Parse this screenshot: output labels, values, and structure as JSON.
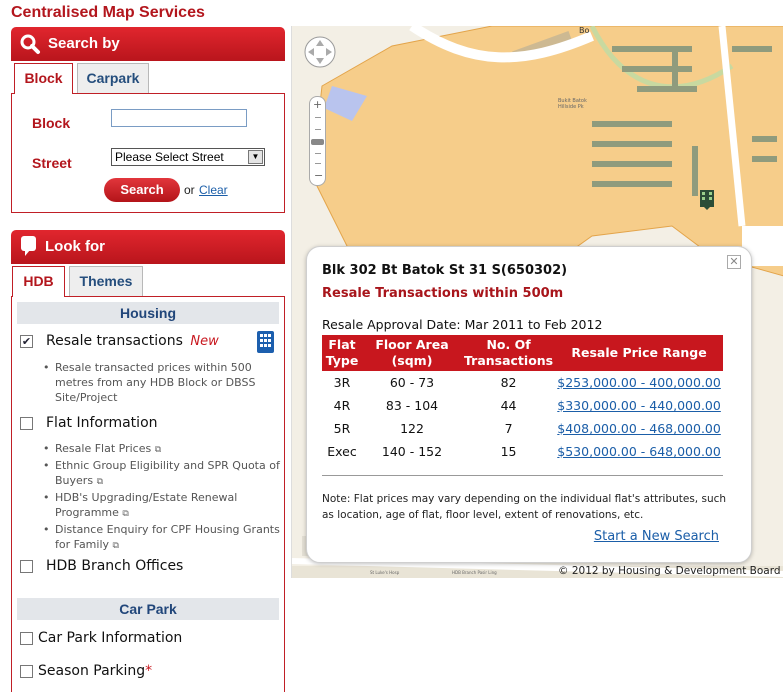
{
  "app_title": "Centralised Map Services",
  "search_panel": {
    "title": "Search by",
    "tabs": [
      {
        "label": "Block"
      },
      {
        "label": "Carpark"
      }
    ],
    "block_label": "Block",
    "block_value": "",
    "street_label": "Street",
    "street_selected": "Please Select Street",
    "search_button": "Search",
    "or_text": "or",
    "clear_link": "Clear"
  },
  "lookfor_panel": {
    "title": "Look for",
    "tabs": [
      {
        "label": "HDB"
      },
      {
        "label": "Themes"
      }
    ],
    "housing": {
      "heading": "Housing",
      "resale": {
        "label": "Resale transactions",
        "new_badge": "New",
        "checked": true,
        "description": "Resale transacted prices within 500 metres from any HDB Block or DBSS Site/Project"
      },
      "flat_info": {
        "label": "Flat Information",
        "checked": false,
        "links": [
          "Resale Flat Prices",
          "Ethnic Group Eligibility and SPR Quota of Buyers",
          "HDB's Upgrading/Estate Renewal Programme",
          "Distance Enquiry for CPF Housing Grants for Family"
        ]
      },
      "branch_offices": {
        "label": "HDB Branch Offices",
        "checked": false
      }
    },
    "car_park": {
      "heading": "Car Park",
      "info": {
        "label": "Car Park Information",
        "checked": false
      },
      "season": {
        "label": "Season Parking",
        "asterisk": "*",
        "checked": false
      }
    }
  },
  "popup": {
    "title": "Blk 302 Bt Batok St 31 S(650302)",
    "subtitle": "Resale Transactions within 500m",
    "approval_date": "Resale Approval Date: Mar 2011 to Feb 2012",
    "headers": [
      "Flat Type",
      "Floor Area (sqm)",
      "No. Of Transactions",
      "Resale Price Range"
    ],
    "rows": [
      {
        "type": "3R",
        "area": "60 - 73",
        "count": "82",
        "range": "$253,000.00 - 400,000.00"
      },
      {
        "type": "4R",
        "area": "83 - 104",
        "count": "44",
        "range": "$330,000.00 - 440,000.00"
      },
      {
        "type": "5R",
        "area": "122",
        "count": "7",
        "range": "$408,000.00 - 468,000.00"
      },
      {
        "type": "Exec",
        "area": "140 - 152",
        "count": "15",
        "range": "$530,000.00 - 648,000.00"
      }
    ],
    "note": "Note: Flat prices may vary depending on the individual flat's attributes, such as location, age of flat, floor level, extent of renovations, etc.",
    "new_search_link": "Start a New Search",
    "close_icon": "close-icon"
  },
  "map": {
    "copyright": "© 2012 by Housing & Development Board",
    "labels": [
      "Bukit Batok Hillside Pk",
      "St Luke's Hosp",
      "HDB Branch Pasir Ling",
      "Bo"
    ]
  },
  "colors": {
    "brand_red": "#c8171e",
    "link_blue": "#1b5ea8",
    "section_bg": "#e3e6ea"
  }
}
